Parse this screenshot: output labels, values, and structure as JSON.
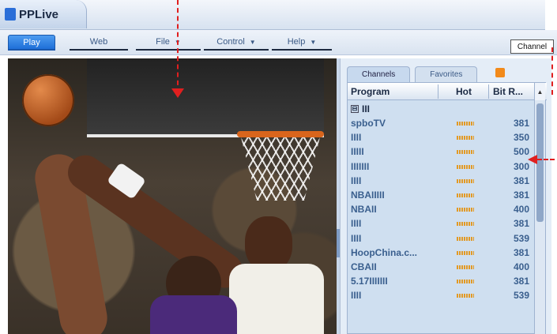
{
  "app": {
    "title": "PPLive"
  },
  "menu": {
    "play": "Play",
    "web": "Web",
    "file": "File",
    "control": "Control",
    "help": "Help",
    "caret": "▼"
  },
  "channel_box": "Channel",
  "panel": {
    "tabs": [
      "Channels",
      "Favorites"
    ],
    "columns": {
      "program": "Program",
      "hot": "Hot",
      "bitrate": "Bit R..."
    },
    "group_label": "III",
    "group_toggle": "⊟",
    "rows": [
      {
        "program": "spboTV",
        "bitrate": "381"
      },
      {
        "program": "IIII",
        "bitrate": "350"
      },
      {
        "program": "IIIII",
        "bitrate": "500"
      },
      {
        "program": "IIIIIII",
        "bitrate": "300"
      },
      {
        "program": "IIII",
        "bitrate": "381"
      },
      {
        "program": "NBAIIIII",
        "bitrate": "381"
      },
      {
        "program": "NBAII",
        "bitrate": "400"
      },
      {
        "program": "IIII",
        "bitrate": "381"
      },
      {
        "program": "IIII",
        "bitrate": "539"
      },
      {
        "program": "HoopChina.c...",
        "bitrate": "381"
      },
      {
        "program": "CBAII",
        "bitrate": "400"
      },
      {
        "program": "5.17IIIIIII",
        "bitrate": "381"
      },
      {
        "program": "IIII",
        "bitrate": "539"
      }
    ]
  },
  "icons": {
    "logo": "pplive-logo-icon",
    "rss": "rss-icon",
    "scroll_up": "scroll-up-arrow-icon"
  },
  "colors": {
    "accent": "#1e6fd8",
    "annotation": "#e01f1f",
    "hot_bar": "#e29a26"
  }
}
